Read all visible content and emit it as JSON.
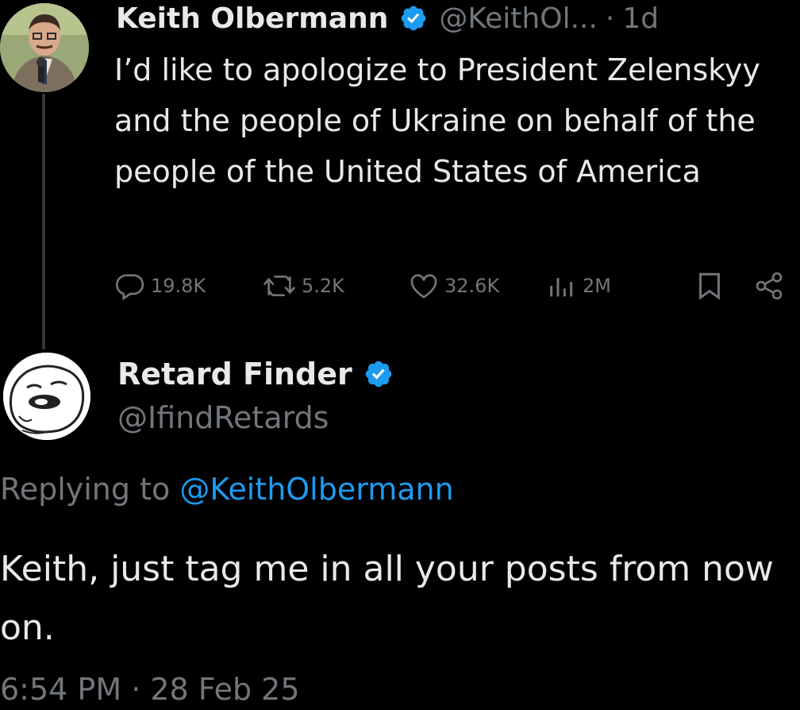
{
  "parent_tweet": {
    "author_name": "Keith Olbermann",
    "author_handle": "@KeithOl...",
    "separator": "·",
    "time": "1d",
    "text": "I’d like to apologize to President Zelenskyy and the people of Ukraine on behalf of the people of the United States of America",
    "replies": "19.8K",
    "reposts": "5.2K",
    "likes": "32.6K",
    "views": "2M"
  },
  "reply_tweet": {
    "author_name": "Retard Finder",
    "author_handle": "@IfindRetards",
    "replying_prefix": "Replying to",
    "replying_to": "@KeithOlbermann",
    "text": "Keith, just tag me in all your posts from now on.",
    "timestamp": "6:54 PM · 28 Feb 25"
  },
  "colors": {
    "background": "#000000",
    "primary_text": "#e7e9ea",
    "secondary_text": "#71767b",
    "accent": "#1d9bf0"
  },
  "icons": [
    "verified-badge-icon",
    "reply-icon",
    "repost-icon",
    "like-icon",
    "views-icon",
    "bookmark-icon",
    "share-icon"
  ]
}
